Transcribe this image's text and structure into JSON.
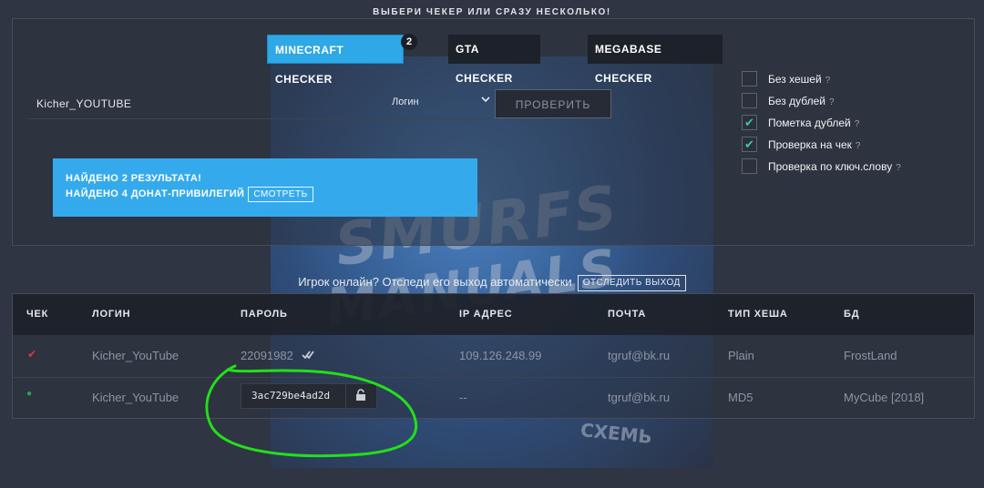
{
  "heading": "ВЫБЕРИ ЧЕКЕР ИЛИ СРАЗУ НЕСКОЛЬКО!",
  "checkers": [
    {
      "label": "MINECRAFT CHECKER",
      "active": true,
      "badge": "2"
    },
    {
      "label": "GTA CHECKER",
      "active": false
    },
    {
      "label": "MEGABASE CHECKER",
      "active": false
    }
  ],
  "search": {
    "value": "Kicher_YOUTUBE",
    "type_select": "Логин",
    "check_button": "ПРОВЕРИТЬ"
  },
  "options": [
    {
      "label": "Без хешей",
      "checked": false,
      "help": "?"
    },
    {
      "label": "Без дублей",
      "checked": false,
      "help": "?"
    },
    {
      "label": "Пометка дублей",
      "checked": true,
      "help": "?"
    },
    {
      "label": "Проверка на чек",
      "checked": true,
      "help": "?"
    },
    {
      "label": "Проверка по ключ.слову",
      "checked": false,
      "help": "?"
    }
  ],
  "alert": {
    "line1": "НАЙДЕНО 2 РЕЗУЛЬТАТА!",
    "line2": "НАЙДЕНО 4 ДОНАТ-ПРИВИЛЕГИЙ",
    "button": "СМОТРЕТЬ"
  },
  "track": {
    "text": "Игрок онлайн? Отследи его выход автоматически",
    "button": "ОТСЛЕДИТЬ ВЫХОД"
  },
  "table": {
    "headers": [
      "ЧЕК",
      "ЛОГИН",
      "ПАРОЛЬ",
      "IP АДРЕС",
      "ПОЧТА",
      "ТИП ХЕША",
      "БД"
    ],
    "rows": [
      {
        "check": "✔",
        "check_color": "#e03a3a",
        "login": "Kicher_YouTube",
        "password": "22091982",
        "ip": "109.126.248.99",
        "email": "tgruf@bk.ru",
        "hash_type": "Plain",
        "db": "FrostLand"
      },
      {
        "check": "●",
        "check_color": "#2fa34f",
        "login": "Kicher_YouTube",
        "password": "3ac729be4ad2d",
        "ip": "--",
        "email": "tgruf@bk.ru",
        "hash_type": "MD5",
        "db": "MyCube [2018]"
      }
    ]
  },
  "watermark": {
    "line1": "SMURFS",
    "line2": "MANUALS",
    "corner": "СХЕМЬ"
  },
  "colors": {
    "accent": "#34aaed",
    "background": "#2f3542",
    "check_green": "#3fc9a1",
    "scribble": "#22e01a"
  }
}
